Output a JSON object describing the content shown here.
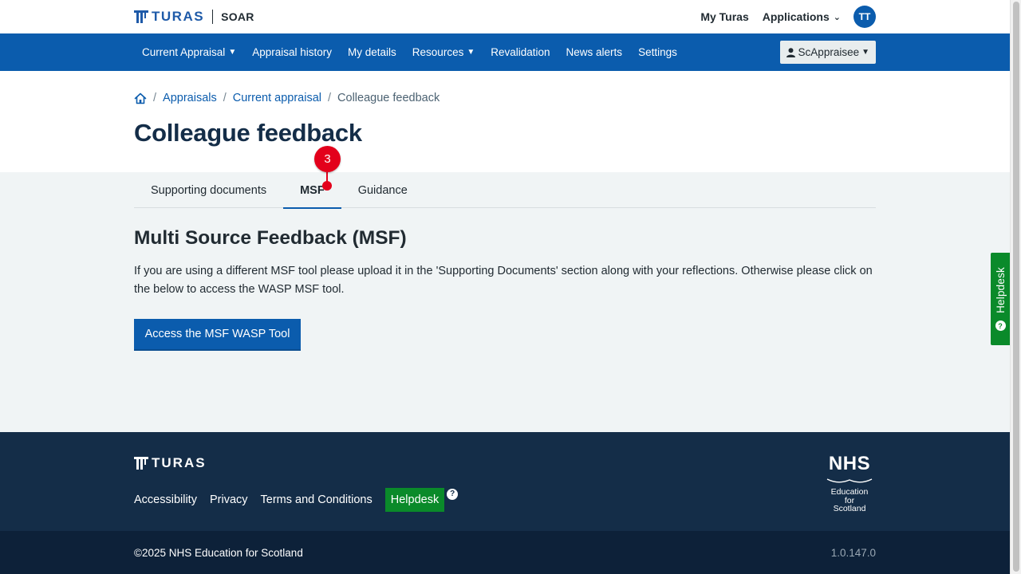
{
  "header": {
    "brand": "TURAS",
    "app_name": "SOAR",
    "links": [
      {
        "label": "My Turas"
      },
      {
        "label": "Applications"
      }
    ],
    "avatar_initials": "TT"
  },
  "nav": {
    "items": [
      {
        "label": "Current Appraisal",
        "has_dropdown": true
      },
      {
        "label": "Appraisal history",
        "has_dropdown": false
      },
      {
        "label": "My details",
        "has_dropdown": false
      },
      {
        "label": "Resources",
        "has_dropdown": true
      },
      {
        "label": "Revalidation",
        "has_dropdown": false
      },
      {
        "label": "News alerts",
        "has_dropdown": false
      },
      {
        "label": "Settings",
        "has_dropdown": false
      }
    ],
    "user_button": "ScAppraisee"
  },
  "breadcrumb": {
    "items": [
      "Appraisals",
      "Current appraisal"
    ],
    "current": "Colleague feedback",
    "separator": "/"
  },
  "page": {
    "title": "Colleague feedback"
  },
  "tabs": {
    "items": [
      {
        "label": "Supporting documents"
      },
      {
        "label": "MSF"
      },
      {
        "label": "Guidance"
      }
    ],
    "active_index": 1,
    "marker_number": "3"
  },
  "section": {
    "title": "Multi Source Feedback (MSF)",
    "description": "If you are using a different MSF tool please upload it in the 'Supporting Documents' section along with your reflections. Otherwise please click on the below to access the WASP MSF tool.",
    "button": "Access the MSF WASP Tool"
  },
  "helpdesk_tab": {
    "label": "Helpdesk"
  },
  "footer": {
    "brand": "TURAS",
    "links": [
      "Accessibility",
      "Privacy",
      "Terms and Conditions"
    ],
    "helpdesk": "Helpdesk",
    "help_glyph": "?",
    "nhs": "NHS",
    "nhs_sub": [
      "Education",
      "for",
      "Scotland"
    ],
    "copyright": "©2025 NHS Education for Scotland",
    "version": "1.0.147.0"
  },
  "colors": {
    "primary": "#0b5cad",
    "title": "#142d48",
    "footer": "#142d48",
    "footer_bottom": "#0d2139",
    "help_green": "#0a8a2a",
    "marker": "#e3001b"
  }
}
